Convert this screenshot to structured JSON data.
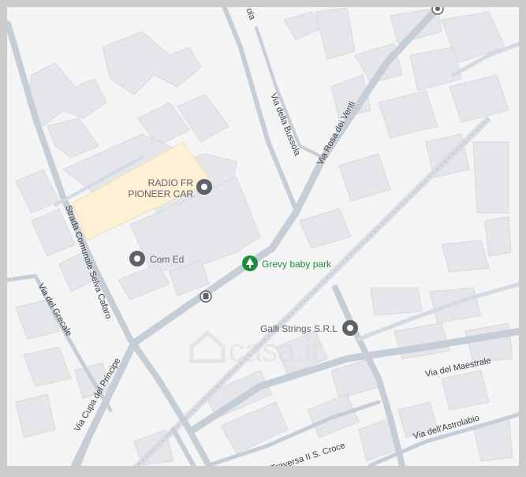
{
  "map": {
    "colors": {
      "background": "#f4f4f5",
      "building": "#e4e6e9",
      "building_stroke": "#d6d9dd",
      "road": "#c5cdd6",
      "road_light": "#d3dae1",
      "road_label": "#3c4043",
      "poi_icon": "#5f6368",
      "park": "#1e8e3e",
      "highlight": "#fdf0d5",
      "frame": "#cbcbcb",
      "watermark": "#dcdcdc"
    },
    "roads": [
      {
        "name": "Via Rosa dei Venti"
      },
      {
        "name": "Via della Bussola"
      },
      {
        "name": "Strada Comunale Selva Cafaro"
      },
      {
        "name": "Via del Grecale"
      },
      {
        "name": "Via Cupa del Principe"
      },
      {
        "name": "Via del Maestrale"
      },
      {
        "name": "Via dell'Astrolabio"
      },
      {
        "name": "Traversa II S. Croce"
      },
      {
        "name": "ola"
      }
    ],
    "pois": [
      {
        "line1": "RADIO FR",
        "line2": "PIONEER CAR",
        "icon": "pin-icon"
      },
      {
        "label": "Com Ed",
        "icon": "pin-icon"
      },
      {
        "label": "Grevy baby park",
        "icon": "park-icon"
      },
      {
        "label": "Galli Strings S.R.L",
        "icon": "pin-icon"
      }
    ],
    "watermark": "casa.it"
  }
}
